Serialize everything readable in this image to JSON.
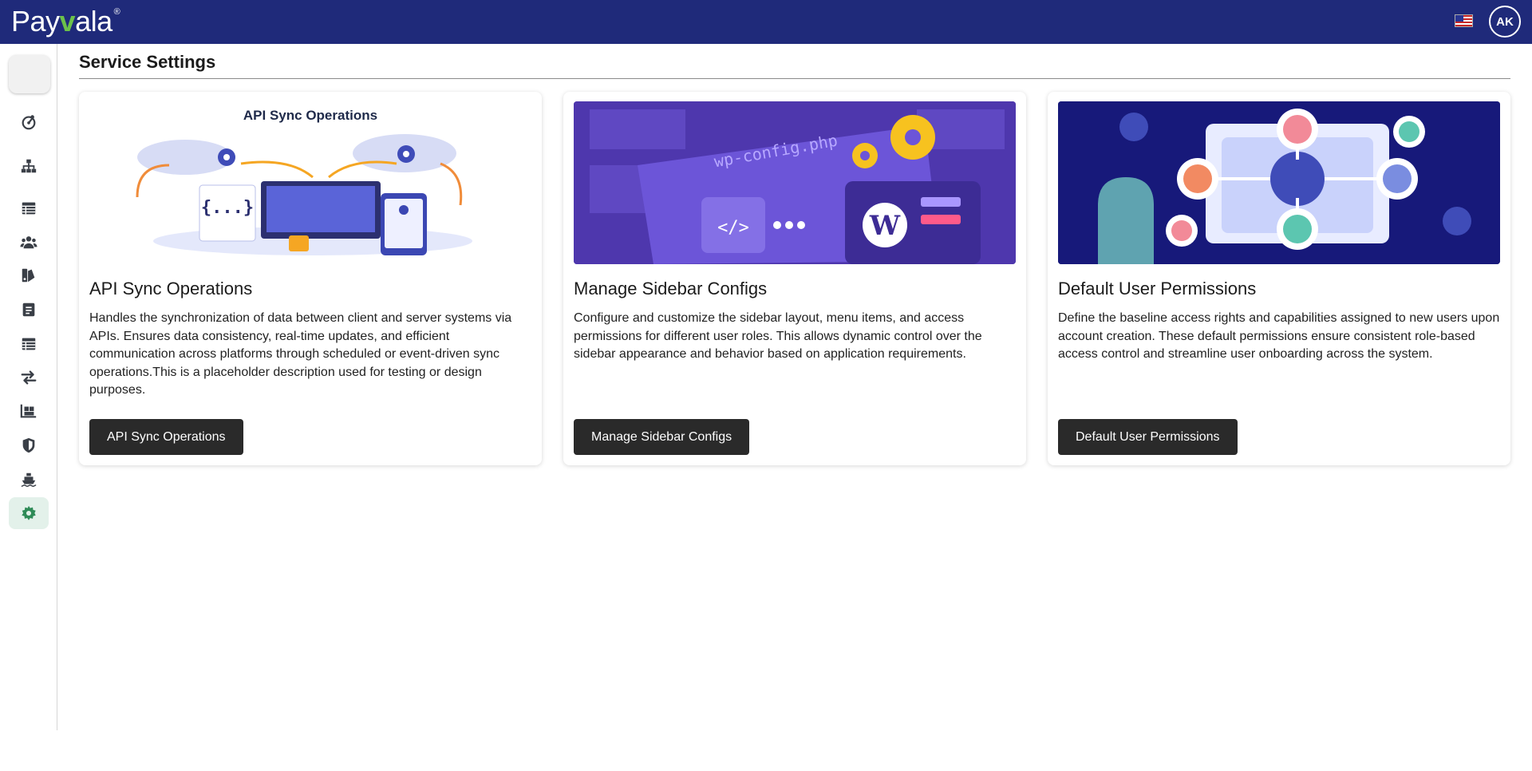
{
  "app": {
    "brand_pre": "Pay",
    "brand_v": "v",
    "brand_post": "ala",
    "brand_mark": "®",
    "user_initials": "AK"
  },
  "page": {
    "title": "Service Settings"
  },
  "sidebar": {
    "items": [
      {
        "icon": "dashboard-icon"
      },
      {
        "icon": "hierarchy-icon"
      },
      {
        "icon": "table-icon"
      },
      {
        "icon": "users-icon"
      },
      {
        "icon": "swatch-icon"
      },
      {
        "icon": "document-icon"
      },
      {
        "icon": "table-icon"
      },
      {
        "icon": "transfer-icon"
      },
      {
        "icon": "warehouse-icon"
      },
      {
        "icon": "shield-icon"
      },
      {
        "icon": "ship-icon"
      },
      {
        "icon": "settings-gear-icon",
        "active": true
      }
    ]
  },
  "cards": [
    {
      "image_caption": "API Sync Operations",
      "image_code": "{...}",
      "title": "API Sync Operations",
      "description": "Handles the synchronization of data between client and server systems via APIs. Ensures data consistency, real-time updates, and efficient communication across platforms through scheduled or event-driven sync operations.This is a placeholder description used for testing or design purposes.",
      "button": "API Sync Operations"
    },
    {
      "image_caption": "wp-config.php",
      "image_code": "</>",
      "title": "Manage Sidebar Configs",
      "description": "Configure and customize the sidebar layout, menu items, and access permissions for different user roles. This allows dynamic control over the sidebar appearance and behavior based on application requirements.",
      "button": "Manage Sidebar Configs"
    },
    {
      "title": "Default User Permissions",
      "description": "Define the baseline access rights and capabilities assigned to new users upon account creation. These default permissions ensure consistent role-based access control and streamline user onboarding across the system.",
      "button": "Default User Permissions"
    }
  ],
  "colors": {
    "topbar": "#1f2a7a",
    "accent_green": "#2e8b57",
    "button": "#2a2a2a"
  }
}
